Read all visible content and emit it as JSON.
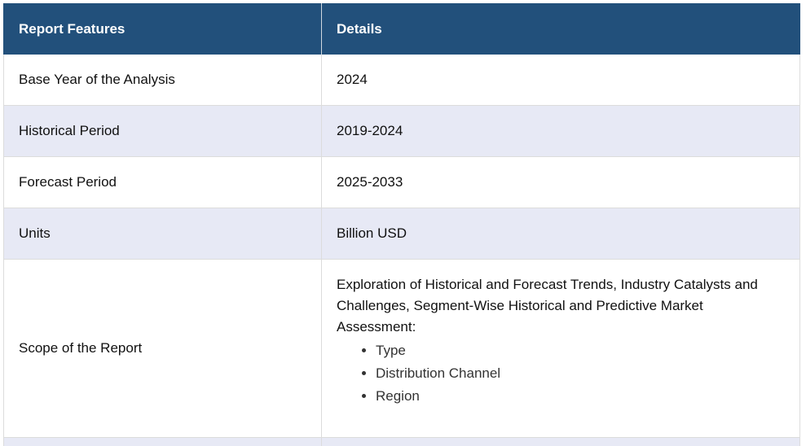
{
  "table": {
    "headers": [
      "Report Features",
      "Details"
    ],
    "rows": [
      {
        "feature": "Base Year of the Analysis",
        "detail": "2024"
      },
      {
        "feature": "Historical Period",
        "detail": "2019-2024"
      },
      {
        "feature": "Forecast Period",
        "detail": "2025-2033"
      },
      {
        "feature": "Units",
        "detail": "Billion USD"
      }
    ],
    "scope": {
      "feature": "Scope of the Report",
      "text": "Exploration of Historical and Forecast Trends, Industry Catalysts and Challenges, Segment-Wise Historical and Predictive Market Assessment:",
      "items": [
        "Type",
        "Distribution Channel",
        "Region"
      ]
    }
  },
  "colors": {
    "header_bg": "#22507b",
    "alt_row_bg": "#e7e9f5"
  }
}
